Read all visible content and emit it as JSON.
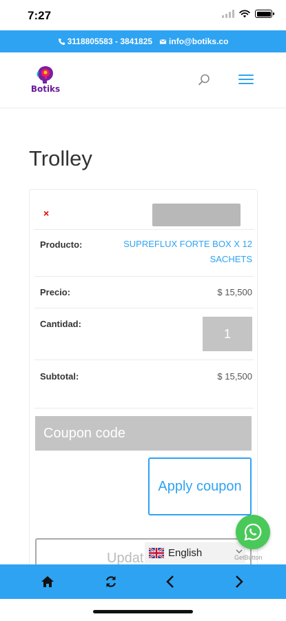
{
  "status_bar": {
    "time": "7:27"
  },
  "top_bar": {
    "phone": "3118805583 - 3841825",
    "email": "info@botiks.co"
  },
  "header": {
    "logo_text": "Botiks"
  },
  "page": {
    "title": "Trolley"
  },
  "cart": {
    "remove_symbol": "×",
    "product_label": "Producto:",
    "product_name": "SUPREFLUX FORTE BOX X 12 SACHETS",
    "price_label": "Precio:",
    "price": "$ 15,500",
    "quantity_label": "Cantidad:",
    "quantity": "1",
    "subtotal_label": "Subtotal:",
    "subtotal": "$ 15,500"
  },
  "coupon": {
    "placeholder": "Coupon code",
    "apply_label": "Apply coupon"
  },
  "update": {
    "label": "Updat"
  },
  "language": {
    "selected": "English"
  },
  "whatsapp": {
    "credit": "GetButton"
  },
  "colors": {
    "accent": "#2ea3f2",
    "whatsapp": "#49c95a",
    "remove": "#e60000"
  }
}
